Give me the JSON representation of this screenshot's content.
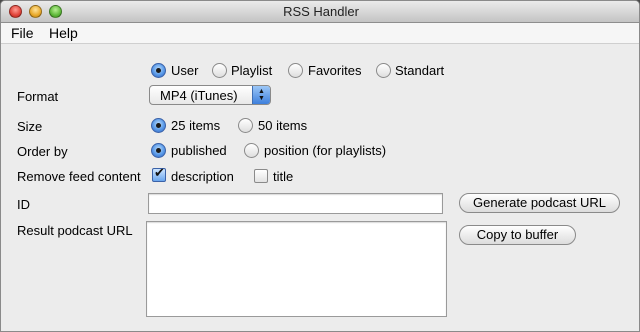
{
  "window": {
    "title": "RSS Handler"
  },
  "menu": {
    "file": "File",
    "help": "Help"
  },
  "source": {
    "options": [
      "User",
      "Playlist",
      "Favorites",
      "Standart"
    ],
    "selected": "User"
  },
  "format": {
    "label": "Format",
    "value": "MP4 (iTunes)"
  },
  "size": {
    "label": "Size",
    "options": [
      "25 items",
      "50 items"
    ],
    "selected": "25 items"
  },
  "order": {
    "label": "Order by",
    "options": [
      "published",
      "position (for playlists)"
    ],
    "selected": "published"
  },
  "remove": {
    "label": "Remove feed content",
    "options": [
      "description",
      "title"
    ],
    "checked": {
      "description": true,
      "title": false
    }
  },
  "id": {
    "label": "ID",
    "value": ""
  },
  "result": {
    "label": "Result podcast URL",
    "value": ""
  },
  "buttons": {
    "generate": "Generate podcast URL",
    "copy": "Copy to buffer"
  }
}
